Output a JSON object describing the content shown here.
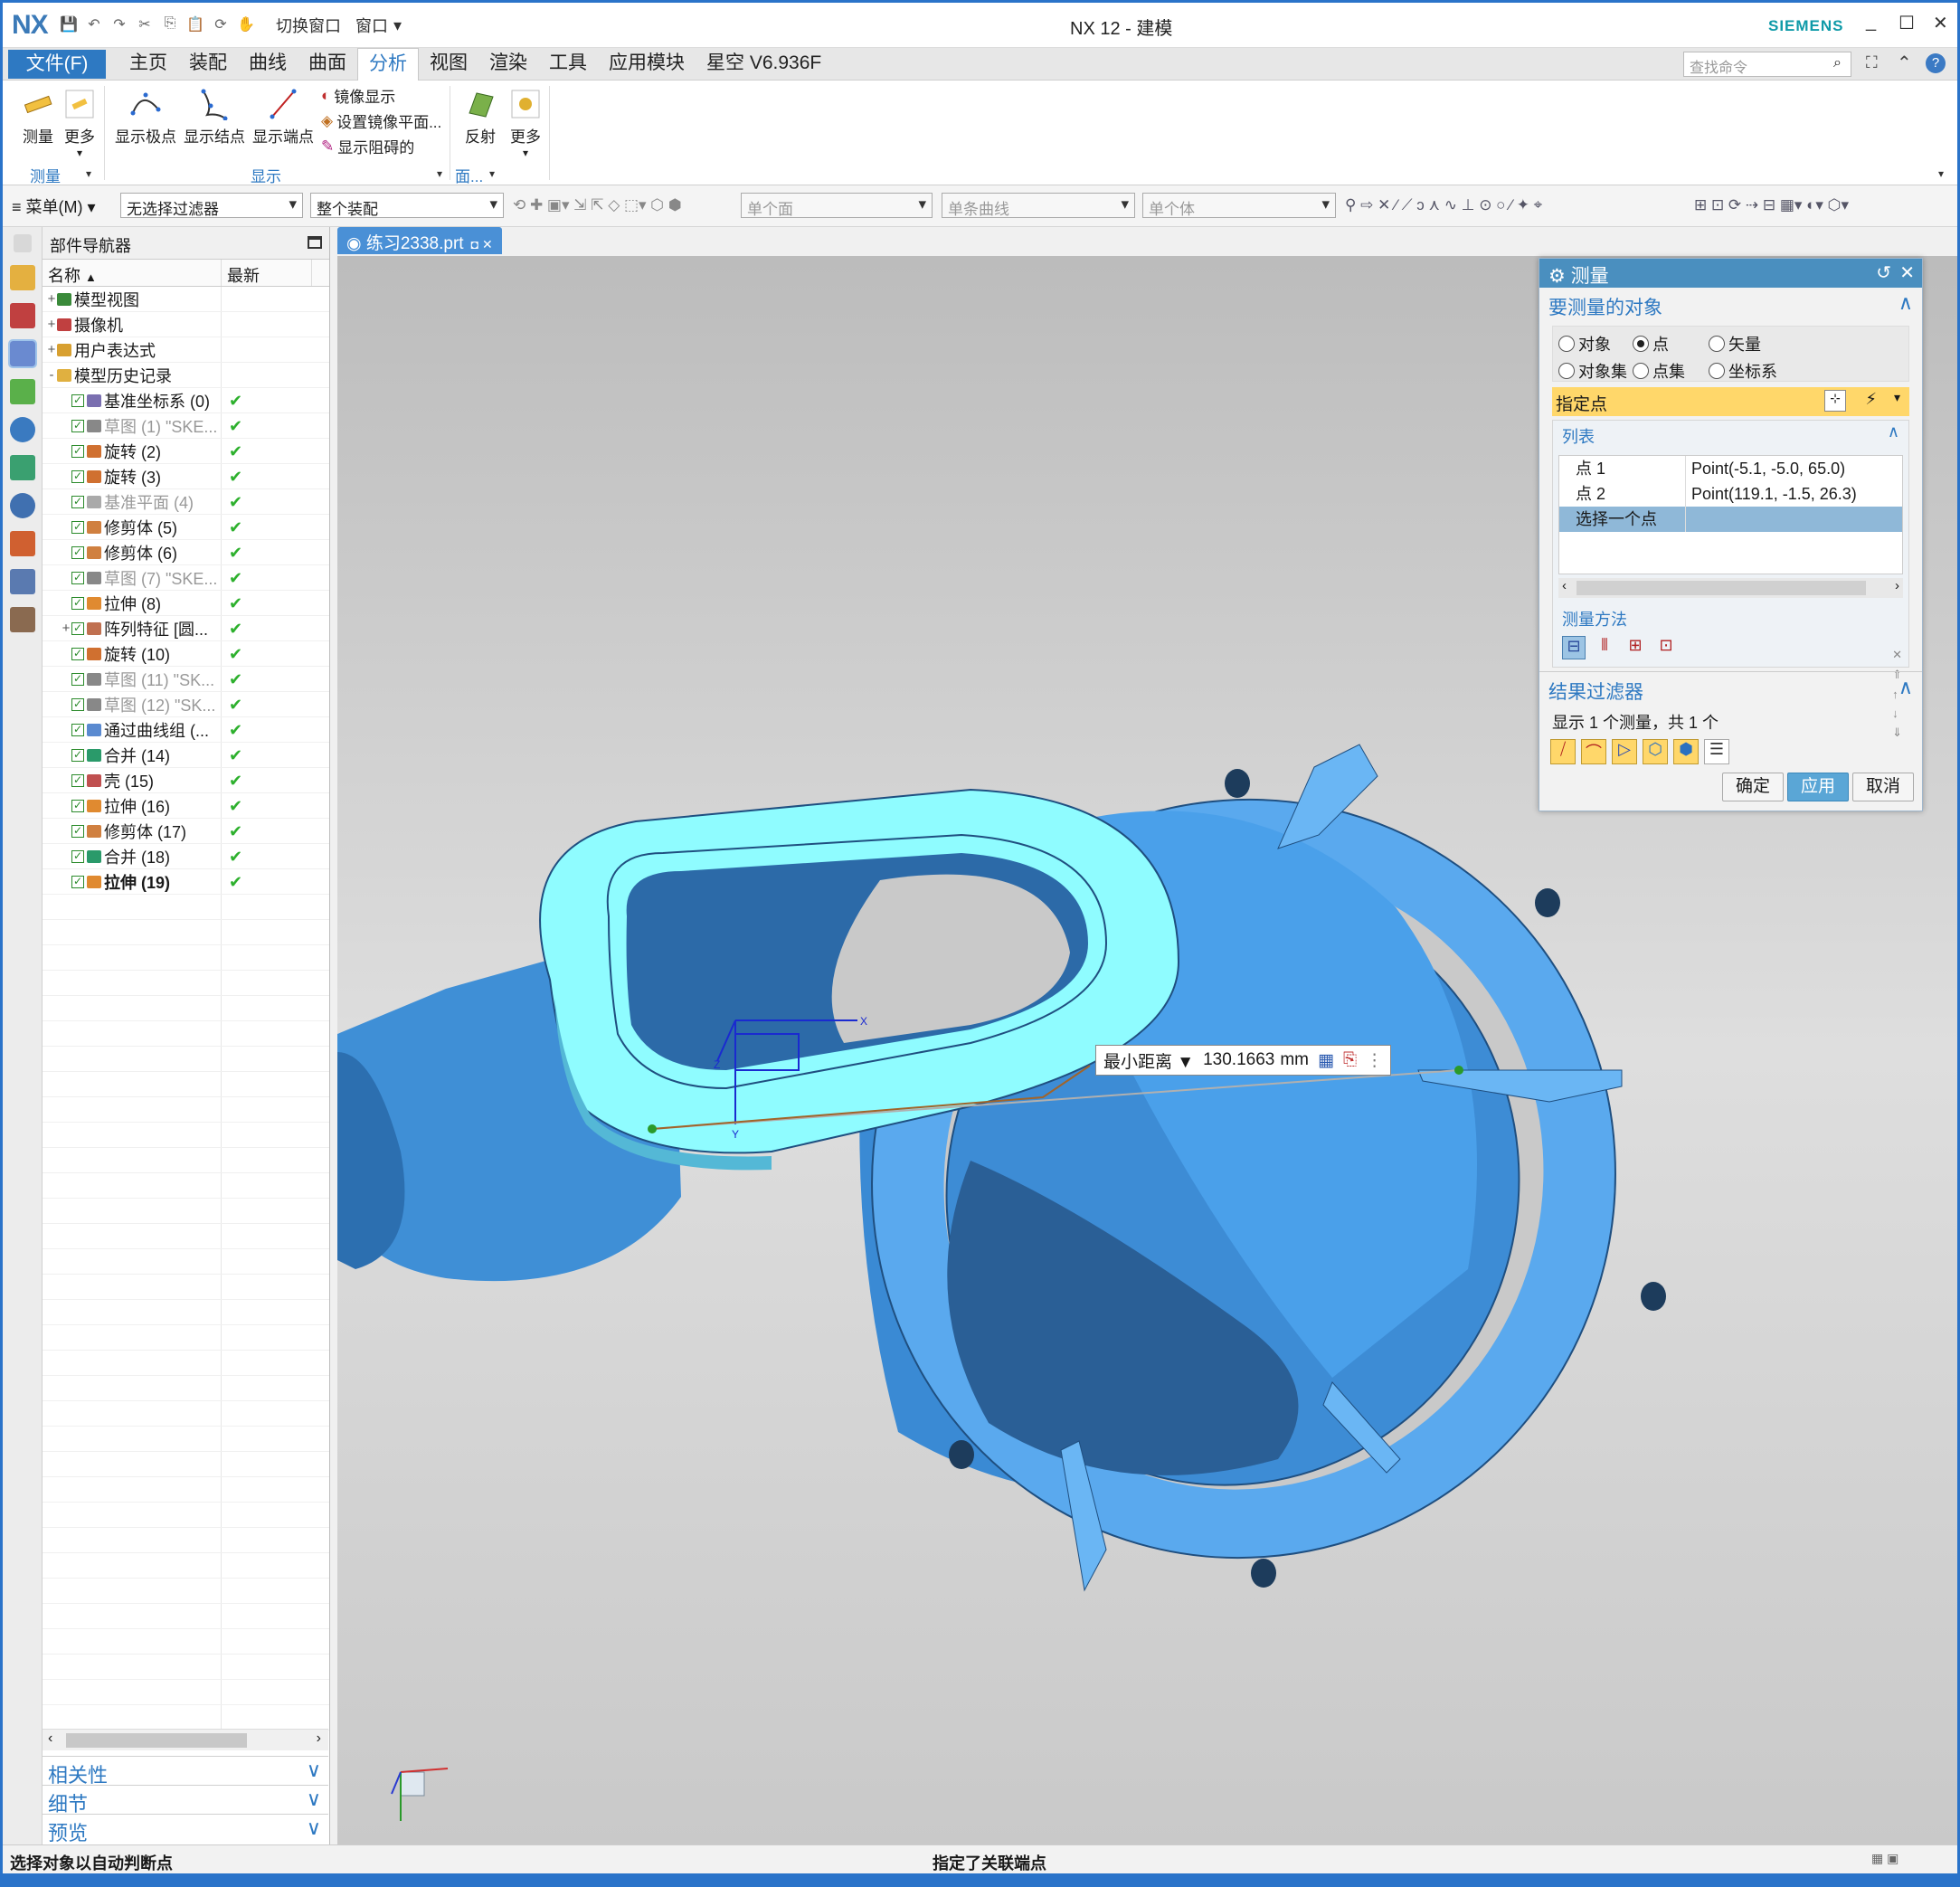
{
  "titlebar": {
    "logo": "NX",
    "switch_window": "切换窗口",
    "window_menu": "窗口",
    "title": "NX 12 - 建模",
    "brand": "SIEMENS",
    "minimize": "_",
    "maximize": "☐",
    "close": "✕"
  },
  "menubar": {
    "file": "文件(F)",
    "tabs": [
      "主页",
      "装配",
      "曲线",
      "曲面",
      "分析",
      "视图",
      "渲染",
      "工具",
      "应用模块",
      "星空 V6.936F"
    ],
    "active_tab": "分析",
    "search_placeholder": "查找命令"
  },
  "ribbon": {
    "measure": "测量",
    "more1": "更多",
    "show_poles": "显示极点",
    "show_knots": "显示结点",
    "show_endpoints": "显示端点",
    "mirror_display": "镜像显示",
    "set_mirror_plane": "设置镜像平面...",
    "show_blocking": "显示阻碍的",
    "reflect": "反射",
    "more2": "更多",
    "group_measure": "测量",
    "group_display": "显示",
    "group_face": "面..."
  },
  "toolbar": {
    "menu": "菜单(M)",
    "filter": "无选择过滤器",
    "assembly": "整个装配",
    "face": "单个面",
    "curve": "单条曲线",
    "body": "单个体"
  },
  "navigator": {
    "title": "部件导航器",
    "col_name": "名称",
    "col_latest": "最新",
    "items": [
      {
        "expand": "+",
        "label": "模型视图",
        "check": false,
        "latest": "",
        "indent": 0,
        "style": "",
        "color": "#3a8a3a"
      },
      {
        "expand": "+",
        "label": "摄像机",
        "check": false,
        "latest": "",
        "indent": 0,
        "style": "",
        "color": "#c04040"
      },
      {
        "expand": "+",
        "label": "用户表达式",
        "check": false,
        "latest": "",
        "indent": 0,
        "style": "",
        "color": "#d8a030"
      },
      {
        "expand": "-",
        "label": "模型历史记录",
        "check": false,
        "latest": "",
        "indent": 0,
        "style": "",
        "color": "#e0b040"
      },
      {
        "expand": "",
        "label": "基准坐标系 (0)",
        "check": true,
        "latest": "✔",
        "indent": 1,
        "style": "",
        "color": "#7a6fb0"
      },
      {
        "expand": "",
        "label": "草图 (1) \"SKE...",
        "check": true,
        "latest": "✔",
        "indent": 1,
        "style": "grey",
        "color": "#888888"
      },
      {
        "expand": "",
        "label": "旋转 (2)",
        "check": true,
        "latest": "✔",
        "indent": 1,
        "style": "",
        "color": "#d07030"
      },
      {
        "expand": "",
        "label": "旋转 (3)",
        "check": true,
        "latest": "✔",
        "indent": 1,
        "style": "",
        "color": "#d07030"
      },
      {
        "expand": "",
        "label": "基准平面 (4)",
        "check": true,
        "latest": "✔",
        "indent": 1,
        "style": "grey",
        "color": "#aaaaaa"
      },
      {
        "expand": "",
        "label": "修剪体 (5)",
        "check": true,
        "latest": "✔",
        "indent": 1,
        "style": "",
        "color": "#d08040"
      },
      {
        "expand": "",
        "label": "修剪体 (6)",
        "check": true,
        "latest": "✔",
        "indent": 1,
        "style": "",
        "color": "#d08040"
      },
      {
        "expand": "",
        "label": "草图 (7) \"SKE...",
        "check": true,
        "latest": "✔",
        "indent": 1,
        "style": "grey",
        "color": "#888888"
      },
      {
        "expand": "",
        "label": "拉伸 (8)",
        "check": true,
        "latest": "✔",
        "indent": 1,
        "style": "",
        "color": "#e08a30"
      },
      {
        "expand": "+",
        "label": "阵列特征 [圆...",
        "check": true,
        "latest": "✔",
        "indent": 1,
        "style": "",
        "color": "#c07050"
      },
      {
        "expand": "",
        "label": "旋转 (10)",
        "check": true,
        "latest": "✔",
        "indent": 1,
        "style": "",
        "color": "#d07030"
      },
      {
        "expand": "",
        "label": "草图 (11) \"SK...",
        "check": true,
        "latest": "✔",
        "indent": 1,
        "style": "grey",
        "color": "#888888"
      },
      {
        "expand": "",
        "label": "草图 (12) \"SK...",
        "check": true,
        "latest": "✔",
        "indent": 1,
        "style": "grey",
        "color": "#888888"
      },
      {
        "expand": "",
        "label": "通过曲线组 (...",
        "check": true,
        "latest": "✔",
        "indent": 1,
        "style": "",
        "color": "#5a8ad0"
      },
      {
        "expand": "",
        "label": "合并 (14)",
        "check": true,
        "latest": "✔",
        "indent": 1,
        "style": "",
        "color": "#2a9a6a"
      },
      {
        "expand": "",
        "label": "壳 (15)",
        "check": true,
        "latest": "✔",
        "indent": 1,
        "style": "",
        "color": "#c05050"
      },
      {
        "expand": "",
        "label": "拉伸 (16)",
        "check": true,
        "latest": "✔",
        "indent": 1,
        "style": "",
        "color": "#e08a30"
      },
      {
        "expand": "",
        "label": "修剪体 (17)",
        "check": true,
        "latest": "✔",
        "indent": 1,
        "style": "",
        "color": "#d08040"
      },
      {
        "expand": "",
        "label": "合并 (18)",
        "check": true,
        "latest": "✔",
        "indent": 1,
        "style": "",
        "color": "#2a9a6a"
      },
      {
        "expand": "",
        "label": "拉伸 (19)",
        "check": true,
        "latest": "✔",
        "indent": 1,
        "style": "bold",
        "color": "#e08a30"
      }
    ],
    "sections": [
      "相关性",
      "细节",
      "预览"
    ]
  },
  "doc_tab": "练习2338.prt",
  "measure_dialog": {
    "title": "测量",
    "objects_section": "要测量的对象",
    "radios": [
      {
        "label": "对象",
        "selected": false
      },
      {
        "label": "点",
        "selected": true
      },
      {
        "label": "矢量",
        "selected": false
      },
      {
        "label": "对象集",
        "selected": false
      },
      {
        "label": "点集",
        "selected": false
      },
      {
        "label": "坐标系",
        "selected": false
      }
    ],
    "specify_point": "指定点",
    "list_label": "列表",
    "list_rows": [
      {
        "key": "点 1",
        "value": "Point(-5.1, -5.0, 65.0)"
      },
      {
        "key": "点 2",
        "value": "Point(119.1, -1.5, 26.3)"
      },
      {
        "key": "选择一个点",
        "value": ""
      }
    ],
    "method_label": "测量方法",
    "result_filter": "结果过滤器",
    "result_text": "显示 1 个测量，共 1 个",
    "ok": "确定",
    "apply": "应用",
    "cancel": "取消"
  },
  "dimension": {
    "type": "最小距离",
    "value": "130.1663",
    "unit": "mm"
  },
  "status": {
    "left": "选择对象以自动判断点",
    "center": "指定了关联端点"
  },
  "colors": {
    "model_blue": "#4aa3ef",
    "model_cyan": "#8ffcff",
    "accent": "#2e79c2",
    "dialog_title": "#4a8fbf",
    "highlight": "#ffd76a"
  }
}
